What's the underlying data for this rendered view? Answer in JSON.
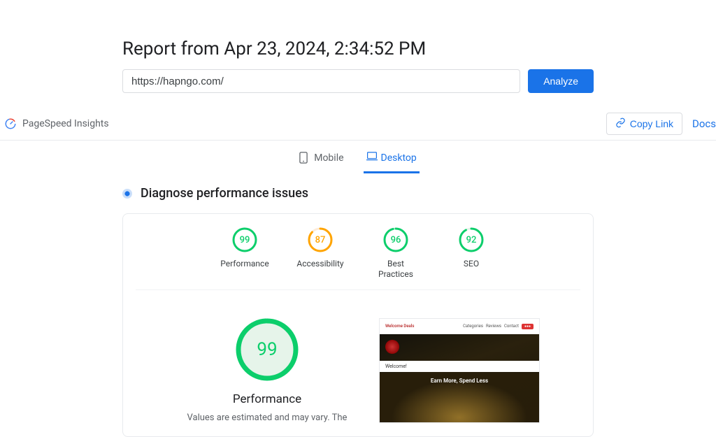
{
  "report": {
    "title": "Report from Apr 23, 2024, 2:34:52 PM",
    "url": "https://hapngo.com/",
    "analyze_label": "Analyze"
  },
  "header": {
    "brand": "PageSpeed Insights",
    "copy_link": "Copy Link",
    "docs": "Docs"
  },
  "tabs": {
    "mobile": "Mobile",
    "desktop": "Desktop"
  },
  "diagnose": {
    "heading": "Diagnose performance issues"
  },
  "scores": [
    {
      "value": "99",
      "label": "Performance",
      "pct": 99,
      "color": "green"
    },
    {
      "value": "87",
      "label": "Accessibility",
      "pct": 87,
      "color": "orange"
    },
    {
      "value": "96",
      "label": "Best Practices",
      "pct": 96,
      "color": "green"
    },
    {
      "value": "92",
      "label": "SEO",
      "pct": 92,
      "color": "green"
    }
  ],
  "main_score": {
    "value": "99",
    "label": "Performance",
    "note": "Values are estimated and may vary. The",
    "pct": 99
  },
  "preview": {
    "nav_brand": "Welcome Deals",
    "nav1": "Categories",
    "nav2": "Reviews",
    "nav3": "Contact",
    "welcome": "Welcome!",
    "hero": "Earn More, Spend Less"
  }
}
